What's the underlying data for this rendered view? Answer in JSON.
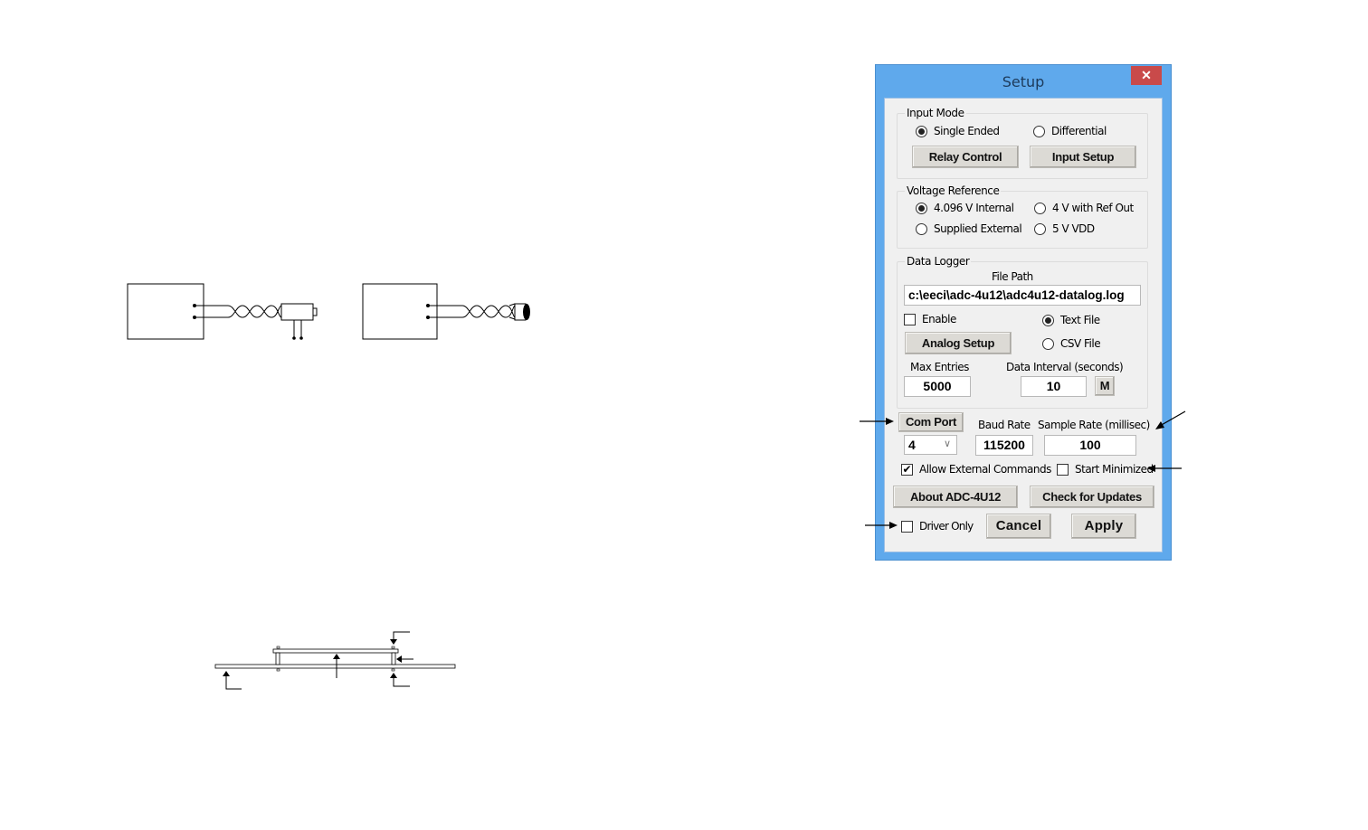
{
  "dialog": {
    "title": "Setup",
    "close_label": "✕",
    "input_mode": {
      "label": "Input Mode",
      "options": [
        {
          "label": "Single Ended",
          "selected": true
        },
        {
          "label": "Differential",
          "selected": false
        }
      ],
      "relay_button": "Relay Control",
      "input_setup_button": "Input Setup"
    },
    "voltage_reference": {
      "label": "Voltage Reference",
      "options": [
        {
          "label": "4.096 V Internal",
          "selected": true
        },
        {
          "label": "4 V with Ref Out",
          "selected": false
        },
        {
          "label": "Supplied External",
          "selected": false
        },
        {
          "label": "5 V VDD",
          "selected": false
        }
      ]
    },
    "data_logger": {
      "label": "Data Logger",
      "file_path_label": "File Path",
      "file_path_value": "c:\\eeci\\adc-4u12\\adc4u12-datalog.log",
      "enable_label": "Enable",
      "enable_checked": false,
      "file_type_options": [
        {
          "label": "Text File",
          "selected": true
        },
        {
          "label": "CSV File",
          "selected": false
        }
      ],
      "analog_setup_button": "Analog Setup",
      "max_entries_label": "Max Entries",
      "max_entries_value": "5000",
      "data_interval_label": "Data Interval (seconds)",
      "data_interval_value": "10",
      "m_button": "M"
    },
    "com_port_button": "Com Port",
    "com_port_value": "4",
    "baud_rate_label": "Baud Rate",
    "baud_rate_value": "115200",
    "sample_rate_label": "Sample Rate (millisec)",
    "sample_rate_value": "100",
    "allow_external_label": "Allow External Commands",
    "allow_external_checked": true,
    "start_minimized_label": "Start Minimized",
    "start_minimized_checked": false,
    "about_button": "About ADC-4U12",
    "updates_button": "Check for Updates",
    "driver_only_label": "Driver Only",
    "driver_only_checked": false,
    "cancel_button": "Cancel",
    "apply_button": "Apply"
  },
  "colors": {
    "window_frame": "#5fa9ec",
    "close_button": "#c94a4a",
    "client_bg": "#f0f0f0",
    "button_bg": "#dcdad5"
  }
}
